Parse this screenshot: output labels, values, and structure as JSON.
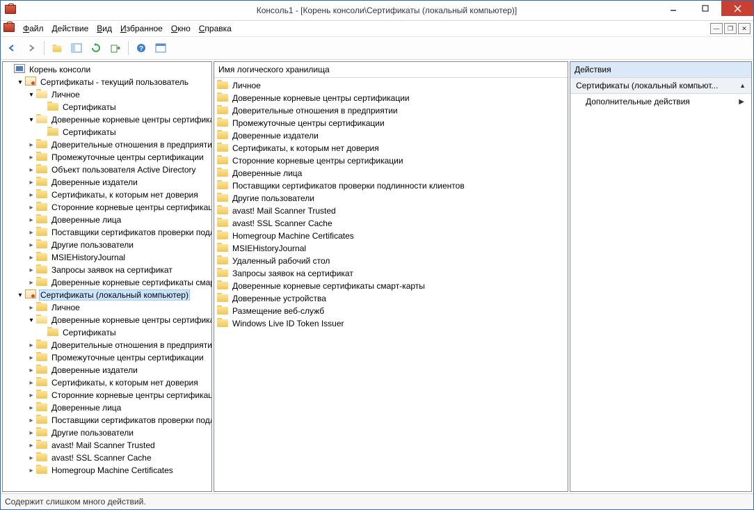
{
  "title": "Консоль1 - [Корень консоли\\Сертификаты (локальный компьютер)]",
  "menu": {
    "file": "Файл",
    "action": "Действие",
    "view": "Вид",
    "favorites": "Избранное",
    "window": "Окно",
    "help": "Справка"
  },
  "tree_root": "Корень консоли",
  "snapin_user": "Сертификаты - текущий пользователь",
  "snapin_local": "Сертификаты (локальный компьютер)",
  "cert_child": "Сертификаты",
  "user_nodes": {
    "personal": "Личное",
    "trusted_root": "Доверенные корневые центры сертификации",
    "enterprise_trust": "Доверительные отношения в предприятии",
    "intermediate": "Промежуточные центры сертификации",
    "ad_user": "Объект пользователя Active Directory",
    "trusted_pub": "Доверенные издатели",
    "untrusted": "Сертификаты, к которым нет доверия",
    "third_party": "Сторонние корневые центры сертификации",
    "trusted_people": "Доверенные лица",
    "client_auth": "Поставщики сертификатов проверки подлинности клиентов",
    "other_people": "Другие пользователи",
    "msie": "MSIEHistoryJournal",
    "cert_enroll": "Запросы заявок на сертификат",
    "smart_card": "Доверенные корневые сертификаты смарт-карты"
  },
  "local_nodes": {
    "personal": "Личное",
    "trusted_root": "Доверенные корневые центры сертификации",
    "enterprise_trust": "Доверительные отношения в предприятии",
    "intermediate": "Промежуточные центры сертификации",
    "trusted_pub": "Доверенные издатели",
    "untrusted": "Сертификаты, к которым нет доверия",
    "third_party": "Сторонние корневые центры сертификации",
    "trusted_people": "Доверенные лица",
    "client_auth": "Поставщики сертификатов проверки подлинности клиентов",
    "other_people": "Другие пользователи",
    "avast_mail": "avast! Mail Scanner Trusted",
    "avast_ssl": "avast! SSL Scanner Cache",
    "homegroup": "Homegroup Machine Certificates"
  },
  "list_header": "Имя логического хранилища",
  "list_items": [
    "Личное",
    "Доверенные корневые центры сертификации",
    "Доверительные отношения в предприятии",
    "Промежуточные центры сертификации",
    "Доверенные издатели",
    "Сертификаты, к которым нет доверия",
    "Сторонние корневые центры сертификации",
    "Доверенные лица",
    "Поставщики сертификатов проверки подлинности клиентов",
    "Другие пользователи",
    "avast! Mail Scanner Trusted",
    "avast! SSL Scanner Cache",
    "Homegroup Machine Certificates",
    "MSIEHistoryJournal",
    "Удаленный рабочий стол",
    "Запросы заявок на сертификат",
    "Доверенные корневые сертификаты смарт-карты",
    "Доверенные устройства",
    "Размещение веб-служб",
    "Windows Live ID Token Issuer"
  ],
  "actions": {
    "header": "Действия",
    "group": "Сертификаты (локальный компьют...",
    "more": "Дополнительные действия"
  },
  "status": "Содержит слишком много действий."
}
